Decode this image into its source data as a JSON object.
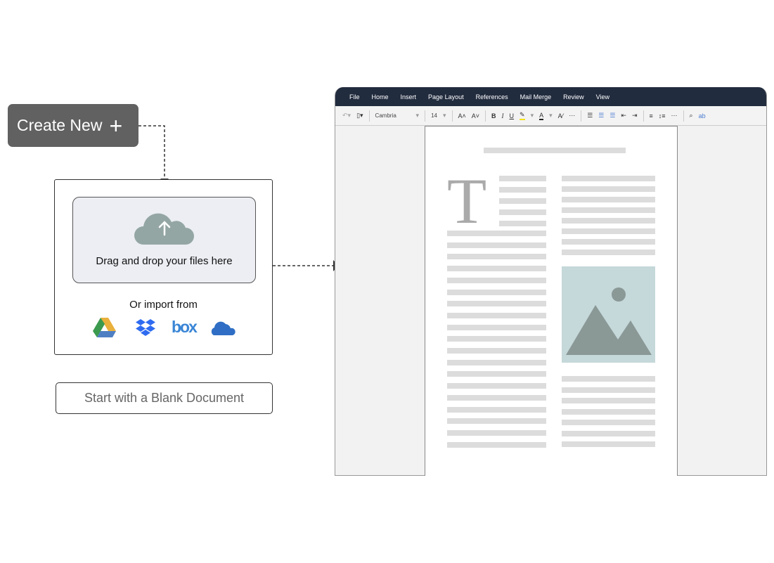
{
  "create_new": {
    "label": "Create New",
    "icon": "plus-icon"
  },
  "upload": {
    "icon": "cloud-upload-icon",
    "drop_text": "Drag and drop your files here",
    "import_label": "Or import from",
    "sources": [
      "google-drive-icon",
      "dropbox-icon",
      "box-icon",
      "onedrive-icon"
    ],
    "box_text": "box"
  },
  "blank_button": "Start with a Blank Document",
  "editor": {
    "menu": [
      "File",
      "Home",
      "Insert",
      "Page Layout",
      "References",
      "Mail Merge",
      "Review",
      "View"
    ],
    "font": "Cambria",
    "font_size": "14",
    "drop_cap": "T"
  },
  "colors": {
    "menubar": "#222c3f",
    "create_button": "#616161",
    "cloud": "#94a6a4",
    "image_bg": "#c5d8da",
    "mountain": "#8a9896"
  }
}
